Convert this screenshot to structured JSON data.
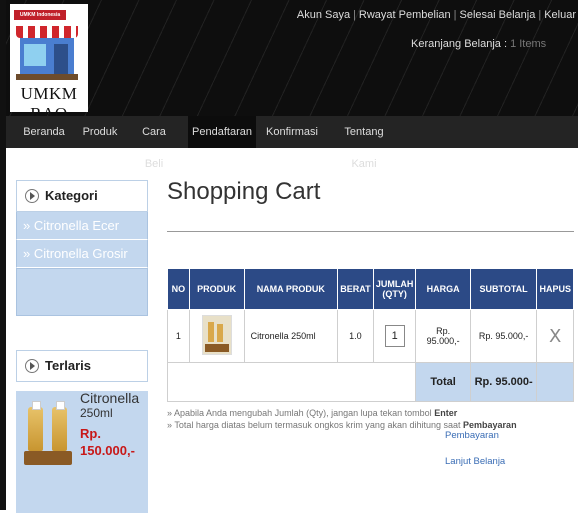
{
  "header": {
    "logo": {
      "sign_text": "UMKM Indonesia",
      "name": "UMKM RAO"
    },
    "top_links": [
      "Akun Saya",
      "Rwayat Pembelian",
      "Selesai Belanja",
      "Keluar"
    ],
    "cart_label": "Keranjang Belanja :",
    "cart_items": "1 Items"
  },
  "nav": [
    "Beranda",
    "Produk",
    "Cara Beli",
    "Pendaftaran",
    "Konfirmasi",
    "Tentang Kami"
  ],
  "sidebar": {
    "kategori_title": "Kategori",
    "categories": [
      "» Citronella Ecer",
      "» Citronella Grosir"
    ],
    "terlaris_title": "Terlaris",
    "product": {
      "name_line1": "Citronella",
      "name_line2": "250ml",
      "price_line1": "Rp.",
      "price_line2": "150.000,-"
    }
  },
  "main": {
    "title": "Shopping Cart",
    "columns": [
      "NO",
      "PRODUK",
      "NAMA PRODUK",
      "BERAT",
      "JUMLAH (QTY)",
      "HARGA",
      "SUBTOTAL",
      "HAPUS"
    ],
    "rows": [
      {
        "no": "1",
        "name": "Citronella 250ml",
        "berat": "1.0",
        "qty": "1",
        "harga": "Rp. 95.000,-",
        "subtotal": "Rp. 95.000,-",
        "hapus": "X"
      }
    ],
    "total_label": "Total",
    "total_value": "Rp. 95.000-",
    "note1_text": "» Apabila Anda mengubah Jumlah (Qty), jangan lupa tekan tombol",
    "note1_bold": "Enter",
    "note2_text": "» Total harga diatas belum termasuk ongkos krim yang akan dihitung saat",
    "note2_bold": "Pembayaran",
    "link_pembayaran": "Pembayaran",
    "link_lanjut": "Lanjut Belanja"
  }
}
